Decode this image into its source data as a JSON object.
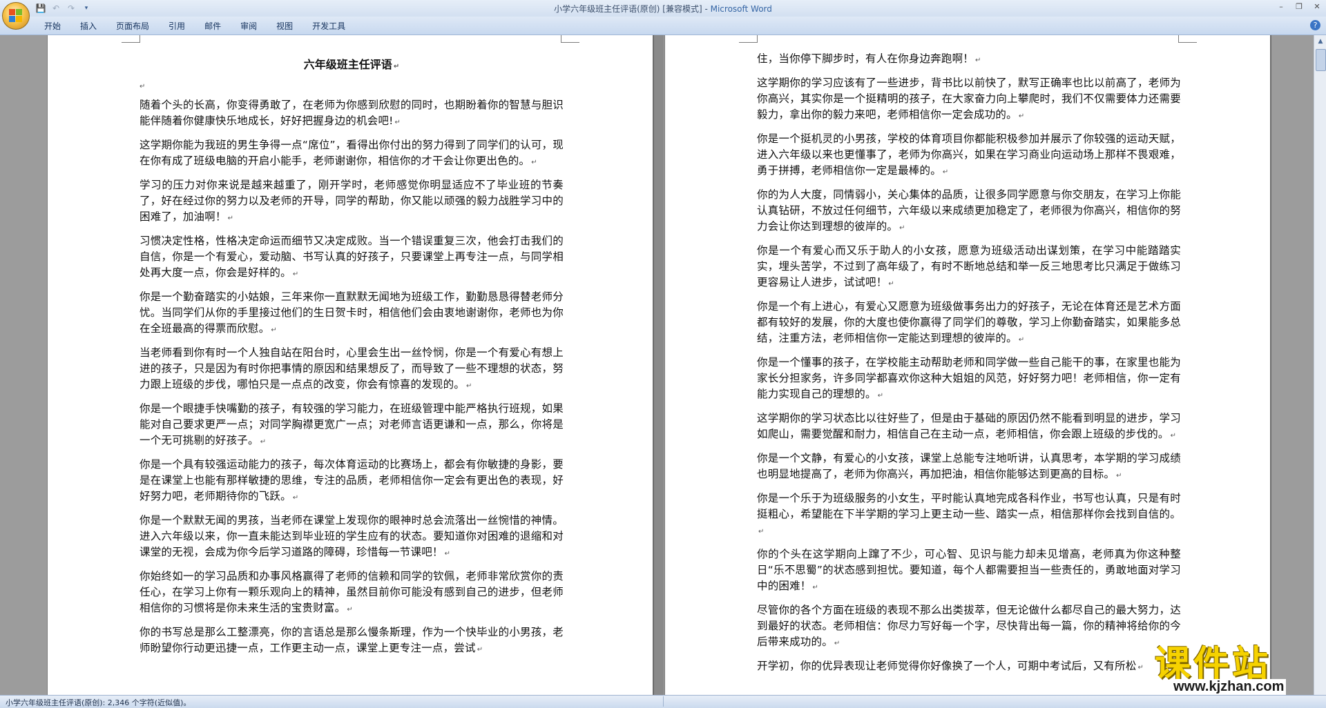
{
  "window": {
    "title": "小学六年级班主任评语(原创) [兼容模式] - ",
    "app_name": "Microsoft Word",
    "controls": [
      "–",
      "❐",
      "✕"
    ]
  },
  "quick_access": {
    "save": "💾",
    "undo": "↶",
    "redo": "↷",
    "customize": "▾"
  },
  "ribbon": {
    "tabs": [
      "开始",
      "插入",
      "页面布局",
      "引用",
      "邮件",
      "审阅",
      "视图",
      "开发工具"
    ],
    "help": "?"
  },
  "document": {
    "heading": "六年级班主任评语",
    "left_paragraphs": [
      "随着个头的长高，你变得勇敢了，在老师为你感到欣慰的同时，也期盼着你的智慧与胆识能伴随着你健康快乐地成长，好好把握身边的机会吧!",
      "这学期你能为我班的男生争得一点“席位”，看得出你付出的努力得到了同学们的认可，现在你有成了班级电脑的开启小能手，老师谢谢你，相信你的才干会让你更出色的。",
      "学习的压力对你来说是越来越重了，刚开学时，老师感觉你明显适应不了毕业班的节奏了，好在经过你的努力以及老师的开导，同学的帮助，你又能以顽强的毅力战胜学习中的困难了，加油啊！",
      "习惯决定性格，性格决定命运而细节又决定成败。当一个错误重复三次，他会打击我们的自信，你是一个有爱心，爱动脑、书写认真的好孩子，只要课堂上再专注一点，与同学相处再大度一点，你会是好样的。",
      "你是一个勤奋踏实的小姑娘，三年来你一直默默无闻地为班级工作，勤勤恳恳得替老师分忧。当同学们从你的手里接过他们的生日贺卡时，相信他们会由衷地谢谢你，老师也为你在全班最高的得票而欣慰。",
      "当老师看到你有时一个人独自站在阳台时，心里会生出一丝怜悯，你是一个有爱心有想上进的孩子，只是因为有时你把事情的原因和结果想反了，而导致了一些不理想的状态，努力跟上班级的步伐，哪怕只是一点点的改变，你会有惊喜的发现的。",
      "你是一个眼捷手快嘴勤的孩子，有较强的学习能力，在班级管理中能严格执行班规，如果能对自己要求更严一点；对同学胸襟更宽广一点；对老师言语更谦和一点，那么，你将是一个无可挑剔的好孩子。",
      "你是一个具有较强运动能力的孩子，每次体育运动的比赛场上，都会有你敏捷的身影，要是在课堂上也能有那样敏捷的思维，专注的品质，老师相信你一定会有更出色的表现，好好努力吧，老师期待你的飞跃。",
      "你是一个默默无闻的男孩，当老师在课堂上发现你的眼神时总会流落出一丝惋惜的神情。进入六年级以来，你一直未能达到毕业班的学生应有的状态。要知道你对困难的退缩和对课堂的无视，会成为你今后学习道路的障碍，珍惜每一节课吧！",
      "你始终如一的学习品质和办事风格赢得了老师的信赖和同学的钦佩，老师非常欣赏你的责任心，在学习上你有一颗乐观向上的精神，虽然目前你可能没有感到自己的进步，但老师相信你的习惯将是你未来生活的宝贵财富。",
      "你的书写总是那么工整漂亮，你的言语总是那么慢条斯理，作为一个快毕业的小男孩，老师盼望你行动更迅捷一点，工作更主动一点，课堂上更专注一点，尝试"
    ],
    "right_paragraphs": [
      "住，当你停下脚步时，有人在你身边奔跑啊！",
      "这学期你的学习应该有了一些进步，背书比以前快了，默写正确率也比以前高了，老师为你高兴，其实你是一个挺精明的孩子，在大家奋力向上攀爬时，我们不仅需要体力还需要毅力，拿出你的毅力来吧，老师相信你一定会成功的。",
      "你是一个挺机灵的小男孩，学校的体育项目你都能积极参加并展示了你较强的运动天赋，进入六年级以来也更懂事了，老师为你高兴，如果在学习商业向运动场上那样不畏艰难，勇于拼搏，老师相信你一定是最棒的。",
      "你的为人大度，同情弱小，关心集体的品质，让很多同学愿意与你交朋友，在学习上你能认真钻研，不放过任何细节，六年级以来成绩更加稳定了，老师很为你高兴，相信你的努力会让你达到理想的彼岸的。",
      "你是一个有爱心而又乐于助人的小女孩，愿意为班级活动出谋划策，在学习中能踏踏实实，埋头苦学，不过到了高年级了，有时不断地总结和举一反三地思考比只满足于做练习更容易让人进步，试试吧！",
      "你是一个有上进心，有爱心又愿意为班级做事务出力的好孩子，无论在体育还是艺术方面都有较好的发展，你的大度也使你赢得了同学们的尊敬，学习上你勤奋踏实，如果能多总结，注重方法，老师相信你一定能达到理想的彼岸的。",
      "你是一个懂事的孩子，在学校能主动帮助老师和同学做一些自己能干的事，在家里也能为家长分担家务，许多同学都喜欢你这种大姐姐的风范，好好努力吧！老师相信，你一定有能力实现自己的理想的。",
      "这学期你的学习状态比以往好些了，但是由于基础的原因仍然不能看到明显的进步，学习如爬山，需要觉醒和耐力，相信自己在主动一点，老师相信，你会跟上班级的步伐的。",
      "你是一个文静，有爱心的小女孩，课堂上总能专注地听讲，认真思考，本学期的学习成绩也明显地提高了，老师为你高兴，再加把油，相信你能够达到更高的目标。",
      "你是一个乐于为班级服务的小女生，平时能认真地完成各科作业，书写也认真，只是有时挺粗心，希望能在下半学期的学习上更主动一些、踏实一点，相信那样你会找到自信的。",
      "你的个头在这学期向上蹿了不少，可心智、见识与能力却未见增高，老师真为你这种整日“乐不思蜀”的状态感到担忧。要知道，每个人都需要担当一些责任的，勇敢地面对学习中的困难！",
      "尽管你的各个方面在班级的表现不那么出类拔萃，但无论做什么都尽自己的最大努力，达到最好的状态。老师相信：你尽力写好每一个字，尽快背出每一篇，你的精神将给你的今后带来成功的。",
      "开学初，你的优异表现让老师觉得你好像换了一个人，可期中考试后，又有所松"
    ]
  },
  "status_bar": {
    "text": "小学六年级班主任评语(原创): 2,346 个字符(近似值)。"
  },
  "watermark": {
    "line1": "课件站",
    "line2": "www.kjzhan.com"
  }
}
